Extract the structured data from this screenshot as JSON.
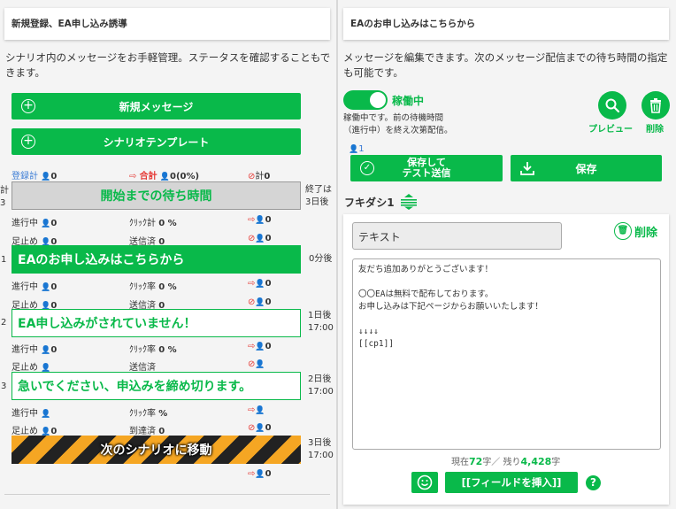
{
  "left": {
    "title": "新規登録、EA申し込み誘導",
    "description": "シナリオ内のメッセージをお手軽管理。ステータスを確認することもできます。",
    "new_message_button": "新規メッセージ",
    "template_button": "シナリオテンプレート",
    "summary": {
      "registered_label": "登録計",
      "registered": "0",
      "total_label": "合計",
      "total": "0(0%)",
      "ban_label": "計",
      "ban": "0"
    },
    "side_top_left": "計\n3",
    "side_end": "終了は\n3日後",
    "wait_block": "開始までの待ち時間",
    "blocks": [
      {
        "num": "",
        "in_progress_label": "進行中",
        "in_progress": "0",
        "click_label": "ｸﾘｯｸ計",
        "click": "0 %",
        "exit": "0",
        "stop_label": "足止め",
        "stop": "0",
        "sent_label": "送信済",
        "sent": "0",
        "ban": "0"
      }
    ],
    "messages": [
      {
        "num": "1",
        "text": "EAのお申し込みはこちらから",
        "timing": "0分後",
        "in_progress_label": "進行中",
        "in_progress": "0",
        "click_label": "ｸﾘｯｸ率",
        "click": "0 %",
        "exit": "0",
        "stop_label": "足止め",
        "stop": "0",
        "sent_label": "送信済",
        "sent": "0",
        "ban": "0"
      },
      {
        "num": "2",
        "text": "EA申し込みがされていません！",
        "timing": "1日後\n17:00",
        "in_progress_label": "進行中",
        "in_progress": "0",
        "click_label": "ｸﾘｯｸ率",
        "click": "0 %",
        "exit": "0",
        "stop_label": "足止め",
        "stop": "",
        "sent_label": "送信済",
        "sent": "",
        "ban": ""
      },
      {
        "num": "3",
        "text": "急いでください、申込みを締め切ります。",
        "timing": "2日後\n17:00",
        "in_progress_label": "進行中",
        "in_progress": "",
        "click_label": "ｸﾘｯｸ率",
        "click": " %",
        "exit": "",
        "stop_label": "足止め",
        "stop": "0",
        "sent_label": "到達済",
        "sent": "0",
        "ban": "0"
      }
    ],
    "next_scenario": {
      "text": "次のシナリオに移動",
      "timing": "3日後\n17:00",
      "exit": "0"
    }
  },
  "right": {
    "title": "EAのお申し込みはこちらから",
    "description": "メッセージを編集できます。次のメッセージ配信までの待ち時間の指定も可能です。",
    "status_label": "稼働中",
    "status_note": "稼働中です。前の待機時間\n（進行中）を終え次第配信。",
    "preview_label": "プレビュー",
    "delete_label": "削除",
    "user_count": "1",
    "save_test_button": "保存して\nテスト送信",
    "save_button": "保存",
    "bubble_title": "フキダシ1",
    "bubble_delete": "削除",
    "type_field": "テキスト",
    "message_body": "友だち追加ありがとうございます！\n\n〇〇EAは無料で配布しております。\nお申し込みは下記ページからお願いいたします！\n\n↓↓↓↓\n[[cp1]]",
    "counter": {
      "prefix": "現在",
      "current": "72",
      "mid": "字／ 残り",
      "remaining": "4,428",
      "suffix": "字"
    },
    "insert_field_button": "[[フィールドを挿入]]"
  },
  "colors": {
    "accent": "#09b94a",
    "link_blue": "#3a7bd5",
    "danger": "#e53935"
  }
}
